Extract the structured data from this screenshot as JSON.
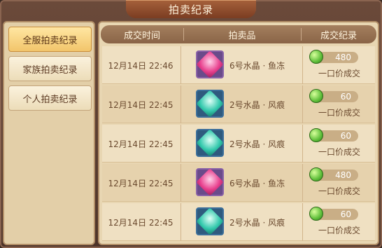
{
  "window": {
    "title": "拍卖纪录"
  },
  "sidebar": {
    "items": [
      {
        "label": "全服拍卖纪录",
        "active": true
      },
      {
        "label": "家族拍卖纪录",
        "active": false
      },
      {
        "label": "个人拍卖纪录",
        "active": false
      }
    ]
  },
  "table": {
    "headers": [
      "成交时间",
      "拍卖品",
      "成交纪录"
    ],
    "rows": [
      {
        "time": "12月14日 22:46",
        "item": "6号水晶 · 鱼冻",
        "gem": "pink-crystal-icon",
        "price": "480",
        "type": "一口价成交"
      },
      {
        "time": "12月14日 22:45",
        "item": "2号水晶 · 风痕",
        "gem": "blue-crystal-icon",
        "price": "60",
        "type": "一口价成交"
      },
      {
        "time": "12月14日 22:45",
        "item": "2号水晶 · 风痕",
        "gem": "blue-crystal-icon",
        "price": "60",
        "type": "一口价成交"
      },
      {
        "time": "12月14日 22:45",
        "item": "6号水晶 · 鱼冻",
        "gem": "pink-crystal-icon",
        "price": "480",
        "type": "一口价成交"
      },
      {
        "time": "12月14日 22:45",
        "item": "2号水晶 · 风痕",
        "gem": "blue-crystal-icon",
        "price": "60",
        "type": "一口价成交"
      }
    ]
  },
  "colors": {
    "accent": "#f2c56b",
    "coin": "#5fbf3a"
  }
}
